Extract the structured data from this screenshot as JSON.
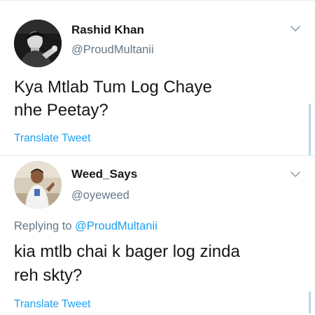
{
  "tweets": [
    {
      "display_name": "Rashid Khan",
      "handle": "@ProudMultanii",
      "text_line1": "Kya Mtlab Tum Log Chaye",
      "text_line2": "nhe Peetay?",
      "translate_label": "Translate Tweet",
      "avatar_icon": "profile-photo-dark",
      "menu_icon": "chevron-down-icon"
    },
    {
      "display_name": "Weed_Says",
      "handle": "@oyeweed",
      "replying_prefix": "Replying to",
      "replying_to": "@ProudMultanii",
      "text_line1": "kia mtlb chai k bager log zinda",
      "text_line2": "reh skty?",
      "translate_label": "Translate Tweet",
      "avatar_icon": "profile-photo-light",
      "menu_icon": "chevron-down-icon"
    }
  ],
  "colors": {
    "link": "#1da1f2",
    "secondary_text": "#657786",
    "primary_text": "#14171a",
    "divider": "#e6ecf0"
  }
}
